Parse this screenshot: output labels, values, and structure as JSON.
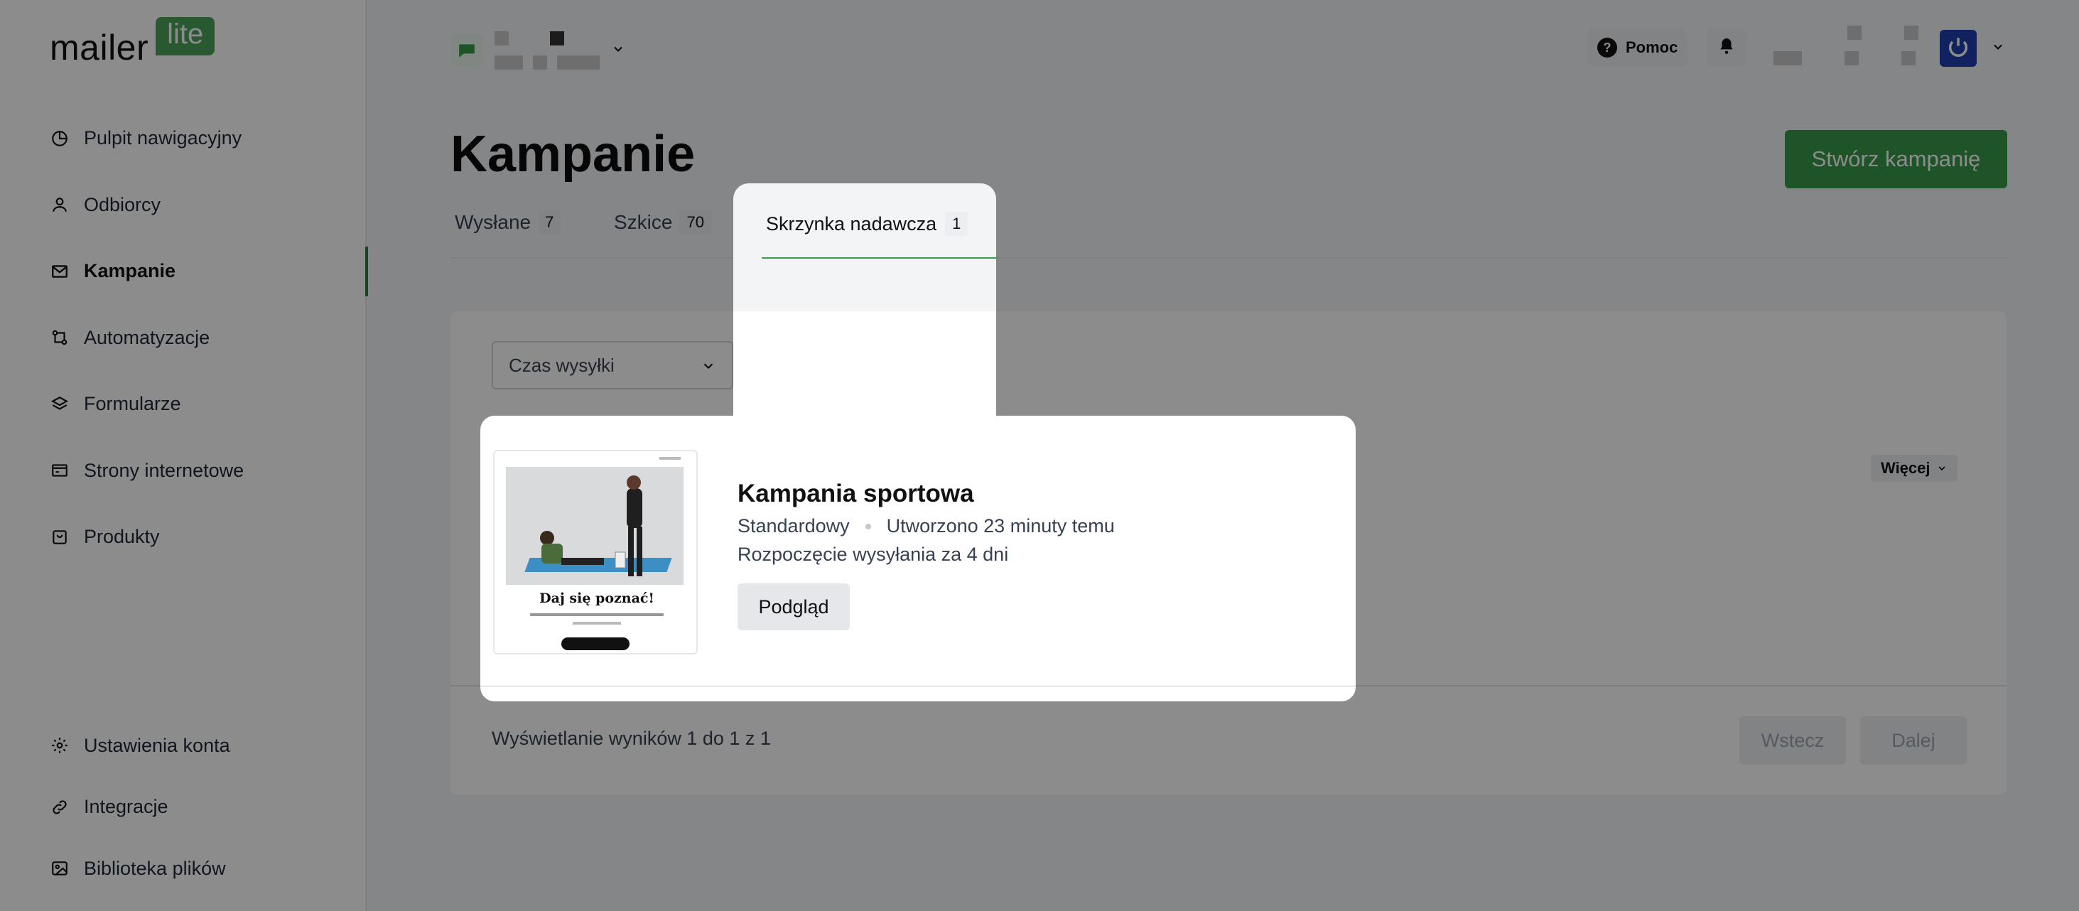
{
  "app": {
    "logo_text": "mailer",
    "logo_badge": "lite"
  },
  "sidebar": {
    "items": [
      {
        "label": "Pulpit nawigacyjny",
        "icon": "pie-chart-icon"
      },
      {
        "label": "Odbiorcy",
        "icon": "user-icon"
      },
      {
        "label": "Kampanie",
        "icon": "mail-icon",
        "active": true
      },
      {
        "label": "Automatyzacje",
        "icon": "flow-icon"
      },
      {
        "label": "Formularze",
        "icon": "layers-icon"
      },
      {
        "label": "Strony internetowe",
        "icon": "browser-icon"
      },
      {
        "label": "Produkty",
        "icon": "bag-icon"
      }
    ],
    "bottom_items": [
      {
        "label": "Ustawienia konta",
        "icon": "gear-icon"
      },
      {
        "label": "Integracje",
        "icon": "link-icon"
      },
      {
        "label": "Biblioteka plików",
        "icon": "image-icon"
      }
    ]
  },
  "topbar": {
    "help_label": "Pomoc"
  },
  "page": {
    "title": "Kampanie",
    "create_button": "Stwórz kampanię"
  },
  "tabs": [
    {
      "label": "Wysłane",
      "count": "7"
    },
    {
      "label": "Szkice",
      "count": "70"
    },
    {
      "label": "Skrzynka nadawcza",
      "count": "1",
      "active": true
    }
  ],
  "list": {
    "sort_label": "Czas wysyłki",
    "more_label": "Więcej",
    "results_text": "Wyświetlanie wyników 1 do 1 z 1",
    "prev_label": "Wstecz",
    "next_label": "Dalej"
  },
  "campaign": {
    "title": "Kampania sportowa",
    "type": "Standardowy",
    "created": "Utworzono 23 minuty temu",
    "schedule": "Rozpoczęcie wysyłania za 4 dni",
    "preview_label": "Podgląd",
    "thumb_heading": "Daj się poznać!"
  },
  "colors": {
    "brand_green": "#3a9a4a",
    "overlay": "rgba(0,0,0,0.45)"
  }
}
